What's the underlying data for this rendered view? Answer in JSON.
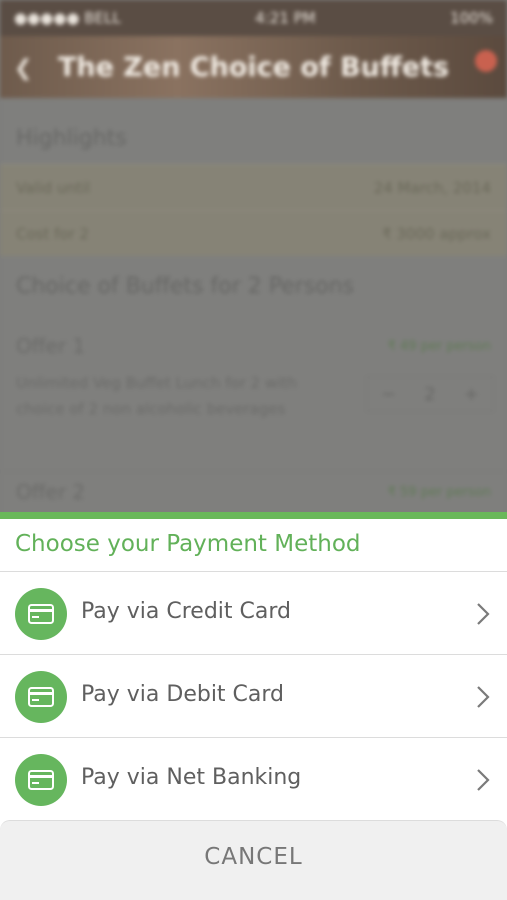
{
  "status_bar": {
    "carrier": "●●●●● BELL",
    "time": "4:21 PM",
    "battery": "100%"
  },
  "hero": {
    "title": "The Zen Choice of Buffets"
  },
  "highlights": {
    "title": "Highlights",
    "rows": [
      {
        "label": "Valid until",
        "value": "24 March, 2014"
      },
      {
        "label": "Cost for 2",
        "value": "₹ 3000 approx"
      }
    ]
  },
  "deal": {
    "title": "Choice of Buffets for 2 Persons",
    "offers": [
      {
        "label": "Offer 1",
        "price": "₹ 49 per person",
        "description": "Unlimited Veg Buffet Lunch for 2 with choice of 2 non alcoholic beverages",
        "quantity": "2",
        "minus": "−",
        "plus": "+"
      },
      {
        "label": "Offer 2",
        "price": "₹ 59 per person"
      }
    ]
  },
  "payment_sheet": {
    "title": "Choose your Payment Method",
    "options": [
      {
        "label": "Pay via Credit Card",
        "icon": "credit-card-icon"
      },
      {
        "label": "Pay via Debit Card",
        "icon": "credit-card-icon"
      },
      {
        "label": "Pay via Net Banking",
        "icon": "credit-card-icon"
      }
    ],
    "cancel_label": "CANCEL"
  },
  "colors": {
    "accent": "#66b65e",
    "text": "#5f5f5f",
    "chevron": "#7a7a7a"
  }
}
